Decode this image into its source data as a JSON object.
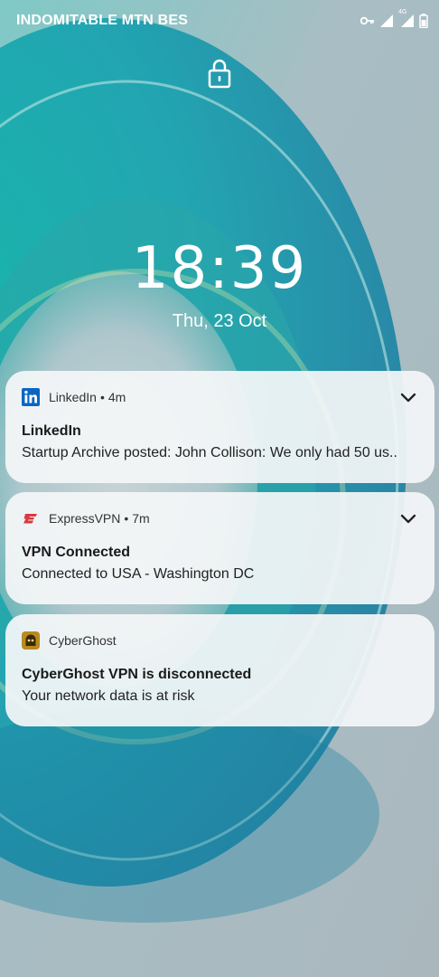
{
  "status_bar": {
    "carrier": "INDOMITABLE MTN BES",
    "network_label": "4G"
  },
  "lockscreen": {
    "time": "18:39",
    "date": "Thu, 23 Oct"
  },
  "notifications": [
    {
      "app": "LinkedIn",
      "separator": "•",
      "time": "4m",
      "title": "LinkedIn",
      "body": "Startup Archive posted: John Collison: We only had 50 us.."
    },
    {
      "app": "ExpressVPN",
      "separator": "•",
      "time": "7m",
      "title": "VPN Connected",
      "body": "Connected to USA - Washington DC"
    },
    {
      "app": "CyberGhost",
      "title": "CyberGhost VPN is disconnected",
      "body": "Your network data is at risk"
    }
  ],
  "colors": {
    "linkedin_blue": "#0a66c2",
    "expressvpn_red": "#da3940",
    "cyberghost_gold": "#b98a1e"
  }
}
